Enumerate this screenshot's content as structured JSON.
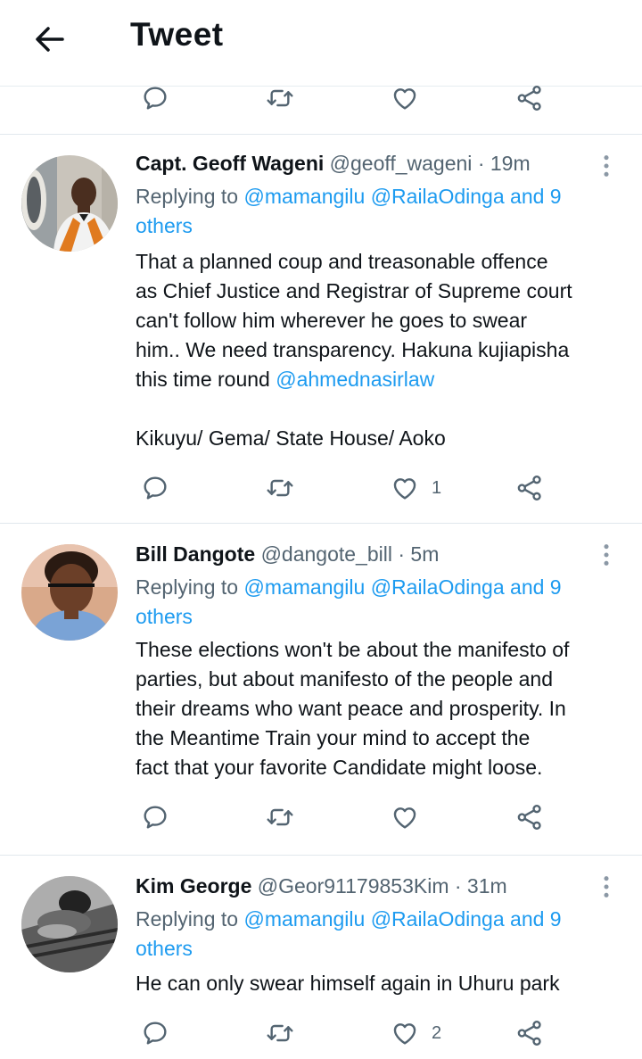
{
  "header": {
    "title": "Tweet"
  },
  "colors": {
    "link": "#1d9bf0",
    "secondary": "#536471",
    "primary": "#0f1419",
    "divider": "#e1e8ed"
  },
  "tweets": [
    {
      "name": "Capt. Geoff Wageni",
      "handle": "@geoff_wageni",
      "time": "· 19m",
      "replying_prefix": "Replying to",
      "replying_users": "@mamangilu @RailaOdinga",
      "replying_and": "and 9",
      "replying_others": "others",
      "body_lines": [
        "That a planned coup and treasonable offence",
        "as Chief Justice and Registrar of Supreme court",
        "can't follow him wherever he goes to swear",
        "him.. We need transparency. Hakuna kujiapisha",
        "this time round"
      ],
      "body_mention": "@ahmednasirlaw",
      "body_extra": "Kikuyu/ Gema/ State House/ Aoko",
      "like_count": "1"
    },
    {
      "name": "Bill Dangote",
      "handle": "@dangote_bill",
      "time": "· 5m",
      "replying_prefix": "Replying to",
      "replying_users": "@mamangilu @RailaOdinga",
      "replying_and": "and 9",
      "replying_others": "others",
      "body_lines": [
        "These elections won't be about the manifesto of",
        "parties, but about manifesto of the people and",
        "their dreams who want peace and prosperity. In",
        "the Meantime Train your mind to accept the",
        "fact that your favorite Candidate might loose."
      ],
      "like_count": ""
    },
    {
      "name": "Kim George",
      "handle": "@Geor91179853Kim",
      "time": "· 31m",
      "replying_prefix": "Replying to",
      "replying_users": "@mamangilu @RailaOdinga",
      "replying_and": "and 9",
      "replying_others": "others",
      "body_lines": [
        "He can only swear himself again in Uhuru park"
      ],
      "like_count": "2"
    }
  ]
}
